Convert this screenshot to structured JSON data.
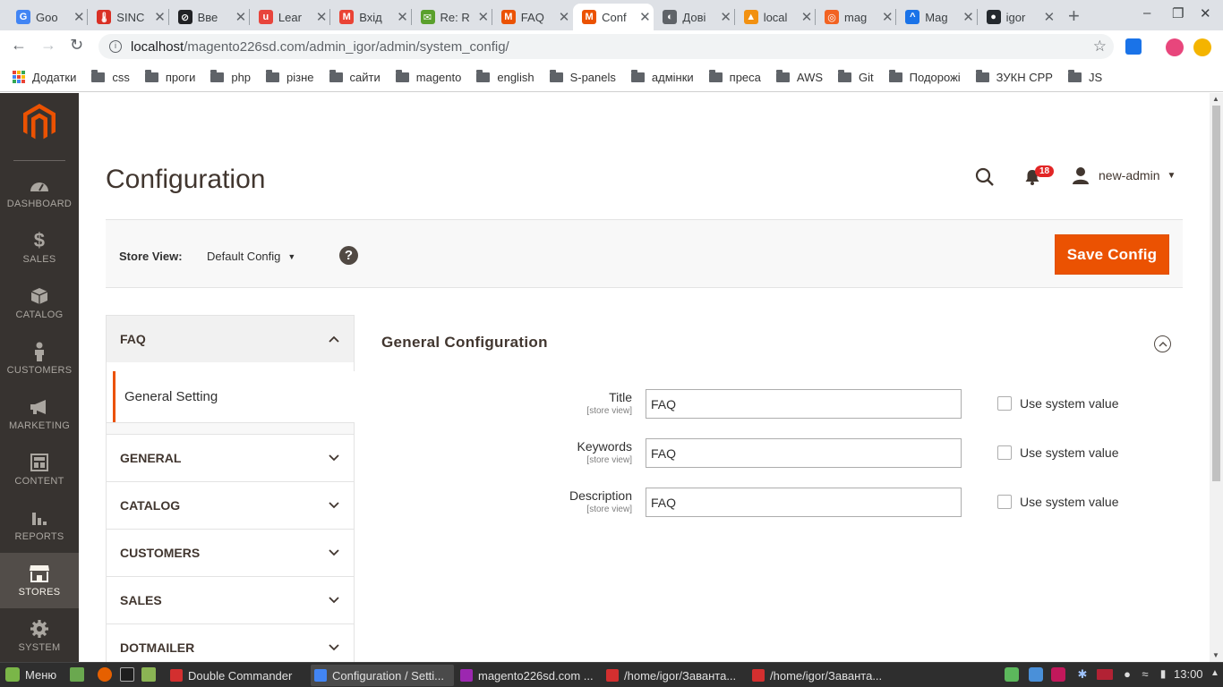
{
  "browser": {
    "tabs": [
      {
        "title": "Goo",
        "color": "#4285f4",
        "letter": "G"
      },
      {
        "title": "SINC",
        "color": "#d93025",
        "letter": "🌡"
      },
      {
        "title": "Вве",
        "color": "#202124",
        "letter": "⊘"
      },
      {
        "title": "Lear",
        "color": "#e8453c",
        "letter": "u"
      },
      {
        "title": "Вхід",
        "color": "#ea4335",
        "letter": "M"
      },
      {
        "title": "Re: R",
        "color": "#5aa02c",
        "letter": "✉"
      },
      {
        "title": "FAQ",
        "color": "#eb5202",
        "letter": "M"
      },
      {
        "title": "Conf",
        "color": "#eb5202",
        "letter": "M"
      },
      {
        "title": "Дові",
        "color": "#5f6368",
        "letter": "◐"
      },
      {
        "title": "local",
        "color": "#f29111",
        "letter": "▲"
      },
      {
        "title": "mag",
        "color": "#f26322",
        "letter": "◎"
      },
      {
        "title": "Mag",
        "color": "#1a73e8",
        "letter": "^"
      },
      {
        "title": "igor",
        "color": "#24292e",
        "letter": "●"
      }
    ],
    "active_tab_index": 7,
    "url_host": "localhost",
    "url_path": "/magento226sd.com/admin_igor/admin/system_config/",
    "bookmarks": [
      "Додатки",
      "css",
      "проги",
      "php",
      "різне",
      "сайти",
      "magento",
      "english",
      "S-panels",
      "адмінки",
      "преса",
      "AWS",
      "Git",
      "Подорожі",
      "ЗУКН СРР",
      "JS"
    ]
  },
  "sidebar": {
    "items": [
      {
        "label": "DASHBOARD",
        "icon": "dashboard-icon"
      },
      {
        "label": "SALES",
        "icon": "dollar-icon"
      },
      {
        "label": "CATALOG",
        "icon": "box-icon"
      },
      {
        "label": "CUSTOMERS",
        "icon": "person-icon"
      },
      {
        "label": "MARKETING",
        "icon": "megaphone-icon"
      },
      {
        "label": "CONTENT",
        "icon": "layout-icon"
      },
      {
        "label": "REPORTS",
        "icon": "bar-chart-icon"
      },
      {
        "label": "STORES",
        "icon": "store-icon"
      },
      {
        "label": "SYSTEM",
        "icon": "gear-icon"
      }
    ],
    "active": "STORES"
  },
  "header": {
    "title": "Configuration",
    "notifications_count": "18",
    "username": "new-admin"
  },
  "store_bar": {
    "label": "Store View:",
    "selected": "Default Config",
    "save_label": "Save Config"
  },
  "config_nav": {
    "open_section": "FAQ",
    "open_item": "General Setting",
    "sections": [
      "GENERAL",
      "CATALOG",
      "CUSTOMERS",
      "SALES",
      "DOTMAILER"
    ]
  },
  "form": {
    "section_title": "General Configuration",
    "fields": [
      {
        "label": "Title",
        "scope": "[store view]",
        "value": "FAQ",
        "system_label": "Use system value"
      },
      {
        "label": "Keywords",
        "scope": "[store view]",
        "value": "FAQ",
        "system_label": "Use system value"
      },
      {
        "label": "Description",
        "scope": "[store view]",
        "value": "FAQ",
        "system_label": "Use system value"
      }
    ]
  },
  "taskbar": {
    "menu_label": "Меню",
    "windows": [
      "Double Commander",
      "Configuration / Setti...",
      "magento226sd.com ...",
      "/home/igor/Заванта...",
      "/home/igor/Заванта..."
    ],
    "active_window_index": 1,
    "clock": "13:00"
  },
  "colors": {
    "accent": "#eb5202",
    "sidebar_bg": "#373330",
    "sidebar_active": "#524d49"
  }
}
